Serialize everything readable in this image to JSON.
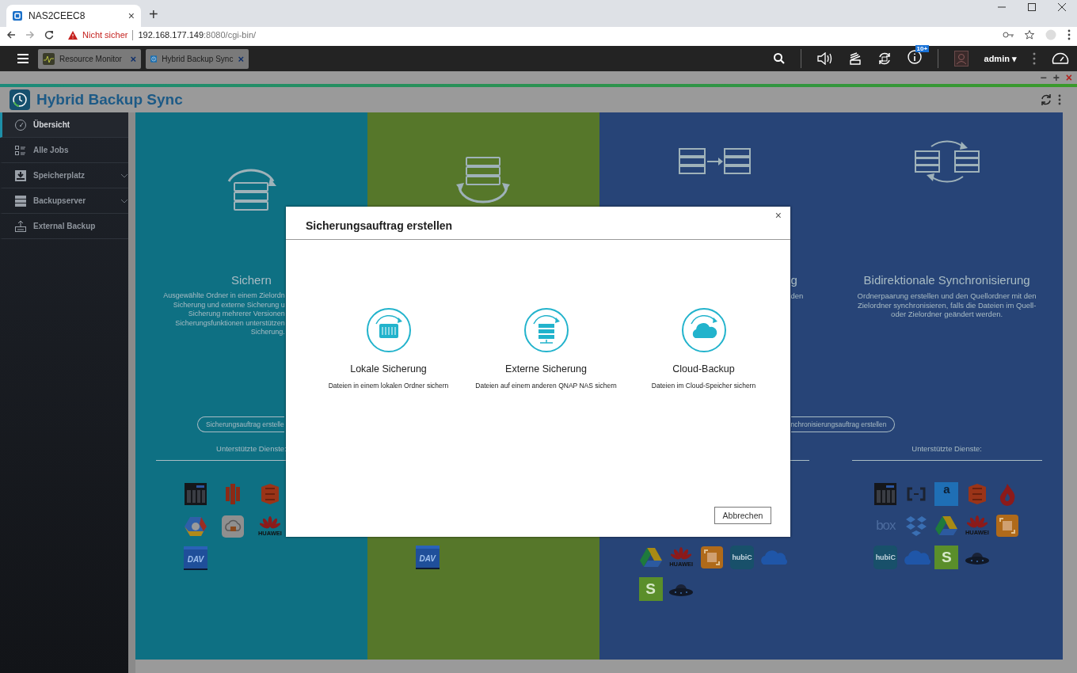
{
  "browser": {
    "tab_title": "NAS2CEEC8",
    "tab_close": "×",
    "new_tab": "+",
    "security_label": "Nicht sicher",
    "url_host": "192.168.177.149",
    "url_rest": ":8080/cgi-bin/"
  },
  "topbar": {
    "apps": [
      {
        "kind": "monitor",
        "label": "Resource Monitor",
        "close": "×"
      },
      {
        "kind": "hbs",
        "label": "Hybrid Backup Sync",
        "close": "×"
      }
    ],
    "badge": "10+",
    "user": "admin",
    "user_caret": "▾"
  },
  "app": {
    "controls": [
      "−",
      "+",
      "×"
    ],
    "title": "Hybrid Backup Sync"
  },
  "sidebar": {
    "items": [
      {
        "kind": "overview",
        "label": "Übersicht",
        "selected": true,
        "submenu": false
      },
      {
        "kind": "jobs",
        "label": "Alle Jobs",
        "selected": false,
        "submenu": false
      },
      {
        "kind": "storage",
        "label": "Speicherplatz",
        "selected": false,
        "submenu": true
      },
      {
        "kind": "server",
        "label": "Backupserver",
        "selected": false,
        "submenu": true
      },
      {
        "kind": "external",
        "label": "External Backup",
        "selected": false,
        "submenu": false
      }
    ]
  },
  "columns": [
    {
      "color": "#0e7083",
      "title": "Sichern",
      "description_lines": [
        "Ausgewählte Ordner in einem Zielordn",
        "Sicherung und externe Sicherung u",
        "Sicherung mehrerer Versionen",
        "Sicherungsfunktionen unterstützen",
        "Sicherung."
      ],
      "button": "Sicherungsauftrag erstelle",
      "services_heading": "Unterstützte Dienste:",
      "top_rows_covered": false,
      "service_rows": [
        [
          {
            "kind": "nas"
          },
          {
            "kind": "aws"
          },
          {
            "kind": "s3"
          }
        ],
        [
          {
            "kind": "gcloud"
          },
          {
            "kind": "cloudbox"
          },
          {
            "kind": "huawei",
            "mark": "HUAWEI"
          }
        ],
        [
          {
            "kind": "dav",
            "mark": "DAV"
          }
        ]
      ]
    },
    {
      "color": "#56772a",
      "top_rows_covered": true,
      "service_rows": [
        [
          {
            "kind": "dav",
            "mark": "DAV"
          }
        ]
      ]
    },
    {
      "color": "#274477",
      "title": "g",
      "description_lines": [
        "den"
      ],
      "button": "nchronisierungsauftrag erstellen",
      "top_rows_covered": true,
      "service_rows": [
        [
          {
            "kind": "gdrive"
          },
          {
            "kind": "huawei",
            "mark": "HUAWEI"
          },
          {
            "kind": "orange"
          },
          {
            "kind": "hubic",
            "mark": "hubiC"
          },
          {
            "kind": "onedrive"
          }
        ],
        [
          {
            "kind": "sync",
            "mark": "S"
          },
          {
            "kind": "ufo"
          }
        ]
      ]
    },
    {
      "color": "#274477",
      "title": "Bidirektionale Synchronisierung",
      "description_lines": [
        "Ordnerpaarung erstellen und den Quellordner mit den",
        "Zielordner synchronisieren, falls die Dateien im Quell-",
        "oder Zielordner geändert werden."
      ],
      "services_heading": "Unterstützte Dienste:",
      "top_rows_covered": false,
      "service_rows": [
        [
          {
            "kind": "nas"
          },
          {
            "kind": "azure"
          },
          {
            "kind": "amazon",
            "mark": "a"
          },
          {
            "kind": "s3"
          },
          {
            "kind": "flame"
          }
        ],
        [
          {
            "kind": "box",
            "mark": "box"
          },
          {
            "kind": "dropbox"
          },
          {
            "kind": "gdrive"
          },
          {
            "kind": "huawei",
            "mark": "HUAWEI"
          },
          {
            "kind": "orange"
          }
        ],
        [
          {
            "kind": "hubic",
            "mark": "hubiC"
          },
          {
            "kind": "onedrive"
          },
          {
            "kind": "sync",
            "mark": "S"
          },
          {
            "kind": "ufo"
          }
        ]
      ]
    }
  ],
  "dialog": {
    "title": "Sicherungsauftrag erstellen",
    "close": "×",
    "options": [
      {
        "kind": "local",
        "title": "Lokale Sicherung",
        "description": "Dateien in einem lokalen Ordner sichern"
      },
      {
        "kind": "remote",
        "title": "Externe Sicherung",
        "description": "Dateien auf einem anderen QNAP NAS sichern"
      },
      {
        "kind": "cloud",
        "title": "Cloud-Backup",
        "description": "Dateien im Cloud-Speicher sichern"
      }
    ],
    "cancel": "Abbrechen"
  }
}
